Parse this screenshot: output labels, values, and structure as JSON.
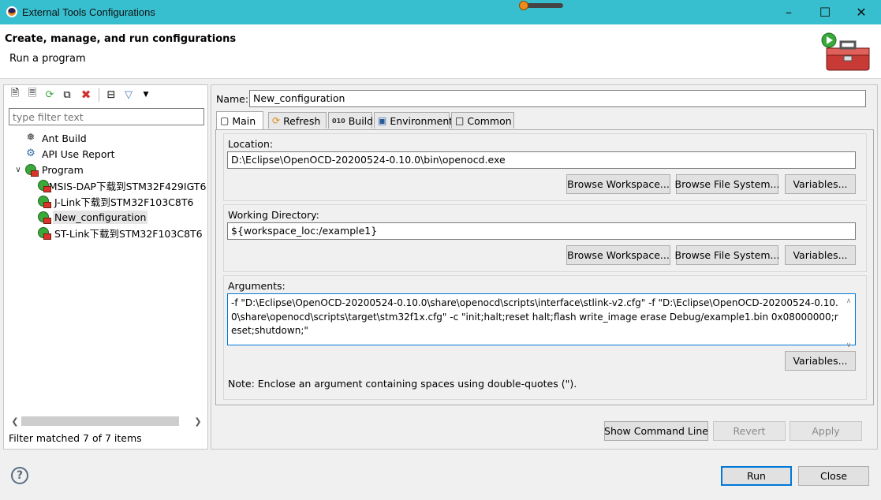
{
  "window": {
    "title": "External Tools Configurations"
  },
  "header": {
    "title": "Create, manage, and run configurations",
    "subtitle": "Run a program"
  },
  "left": {
    "filter_placeholder": "type filter text",
    "tree": [
      {
        "label": "Ant Build",
        "icon": "ant-build-icon",
        "indent": 0,
        "expandable": false,
        "selected": false
      },
      {
        "label": "API Use Report",
        "icon": "api-report-icon",
        "indent": 0,
        "expandable": false,
        "selected": false
      },
      {
        "label": "Program",
        "icon": "program-icon",
        "indent": 0,
        "expandable": true,
        "expanded": true,
        "selected": false
      },
      {
        "label": "CMSIS-DAP下载到STM32F429IGT6",
        "icon": "program-config-icon",
        "indent": 1,
        "selected": false
      },
      {
        "label": "J-Link下载到STM32F103C8T6",
        "icon": "program-config-icon",
        "indent": 1,
        "selected": false
      },
      {
        "label": "New_configuration",
        "icon": "program-config-icon",
        "indent": 1,
        "selected": true
      },
      {
        "label": "ST-Link下载到STM32F103C8T6",
        "icon": "program-config-icon",
        "indent": 1,
        "selected": false
      }
    ],
    "status": "Filter matched 7 of 7 items"
  },
  "right": {
    "name_label": "Name:",
    "name_value": "New_configuration",
    "tabs": [
      {
        "label": "Main",
        "icon": "main-tab-icon",
        "active": true
      },
      {
        "label": "Refresh",
        "icon": "refresh-icon",
        "active": false
      },
      {
        "label": "Build",
        "icon": "build-icon",
        "active": false
      },
      {
        "label": "Environment",
        "icon": "environment-icon",
        "active": false
      },
      {
        "label": "Common",
        "icon": "common-icon",
        "active": false
      }
    ],
    "location": {
      "label": "Location:",
      "value": "D:\\Eclipse\\OpenOCD-20200524-0.10.0\\bin\\openocd.exe",
      "browse_ws": "Browse Workspace...",
      "browse_fs": "Browse File System...",
      "variables": "Variables..."
    },
    "workdir": {
      "label": "Working Directory:",
      "value": "${workspace_loc:/example1}",
      "browse_ws": "Browse Workspace...",
      "browse_fs": "Browse File System...",
      "variables": "Variables..."
    },
    "arguments": {
      "label": "Arguments:",
      "value": "-f \"D:\\Eclipse\\OpenOCD-20200524-0.10.0\\share\\openocd\\scripts\\interface\\stlink-v2.cfg\" -f \"D:\\Eclipse\\OpenOCD-20200524-0.10.0\\share\\openocd\\scripts\\target\\stm32f1x.cfg\" -c \"init;halt;reset halt;flash write_image erase Debug/example1.bin 0x08000000;reset;shutdown;\"",
      "variables": "Variables...",
      "note": "Note: Enclose an argument containing spaces using double-quotes (\")."
    },
    "show_cmd": "Show Command Line",
    "revert": "Revert",
    "apply": "Apply"
  },
  "footer": {
    "run": "Run",
    "close": "Close"
  }
}
